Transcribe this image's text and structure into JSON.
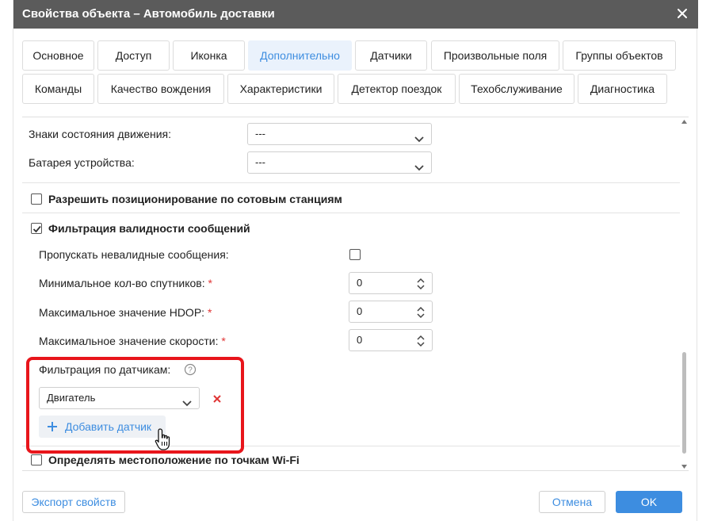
{
  "dialog": {
    "title": "Свойства объекта – Автомобиль доставки",
    "close_icon": "close-icon"
  },
  "tabs": {
    "row1": [
      "Основное",
      "Доступ",
      "Иконка",
      "Дополнительно",
      "Датчики",
      "Произвольные поля",
      "Группы объектов"
    ],
    "row2": [
      "Команды",
      "Качество вождения",
      "Характеристики",
      "Детектор поездок",
      "Техобслуживание",
      "Диагностика"
    ],
    "active": "Дополнительно"
  },
  "fields": {
    "motion_signs": {
      "label": "Знаки состояния движения:",
      "value": "---"
    },
    "battery": {
      "label": "Батарея устройства:",
      "value": "---"
    },
    "cell_positioning": {
      "label": "Разрешить позиционирование по сотовым станциям",
      "checked": false
    },
    "validity_filter": {
      "label": "Фильтрация валидности сообщений",
      "checked": true
    },
    "skip_invalid": {
      "label": "Пропускать невалидные сообщения:",
      "checked": false
    },
    "min_satellites": {
      "label": "Минимальное кол-во спутников:",
      "required": "*",
      "value": "0"
    },
    "max_hdop": {
      "label": "Максимальное значение HDOP:",
      "required": "*",
      "value": "0"
    },
    "max_speed": {
      "label": "Максимальное значение скорости:",
      "required": "*",
      "value": "0"
    },
    "sensor_filter": {
      "label": "Фильтрация по датчикам:",
      "help_icon": "help-circle-icon"
    },
    "sensor_select": {
      "value": "Двигатель",
      "remove_icon": "remove-x-icon"
    },
    "add_sensor": {
      "label": "Добавить датчик",
      "icon": "plus-icon"
    },
    "wifi_positioning": {
      "label": "Определять местоположение по точкам Wi-Fi",
      "checked": false
    }
  },
  "footer": {
    "export_label": "Экспорт свойств",
    "cancel_label": "Отмена",
    "ok_label": "OK"
  },
  "colors": {
    "titlebar": "#5b5b5b",
    "accent": "#3d8de0",
    "highlight": "#e8151b",
    "required": "#e03535"
  }
}
